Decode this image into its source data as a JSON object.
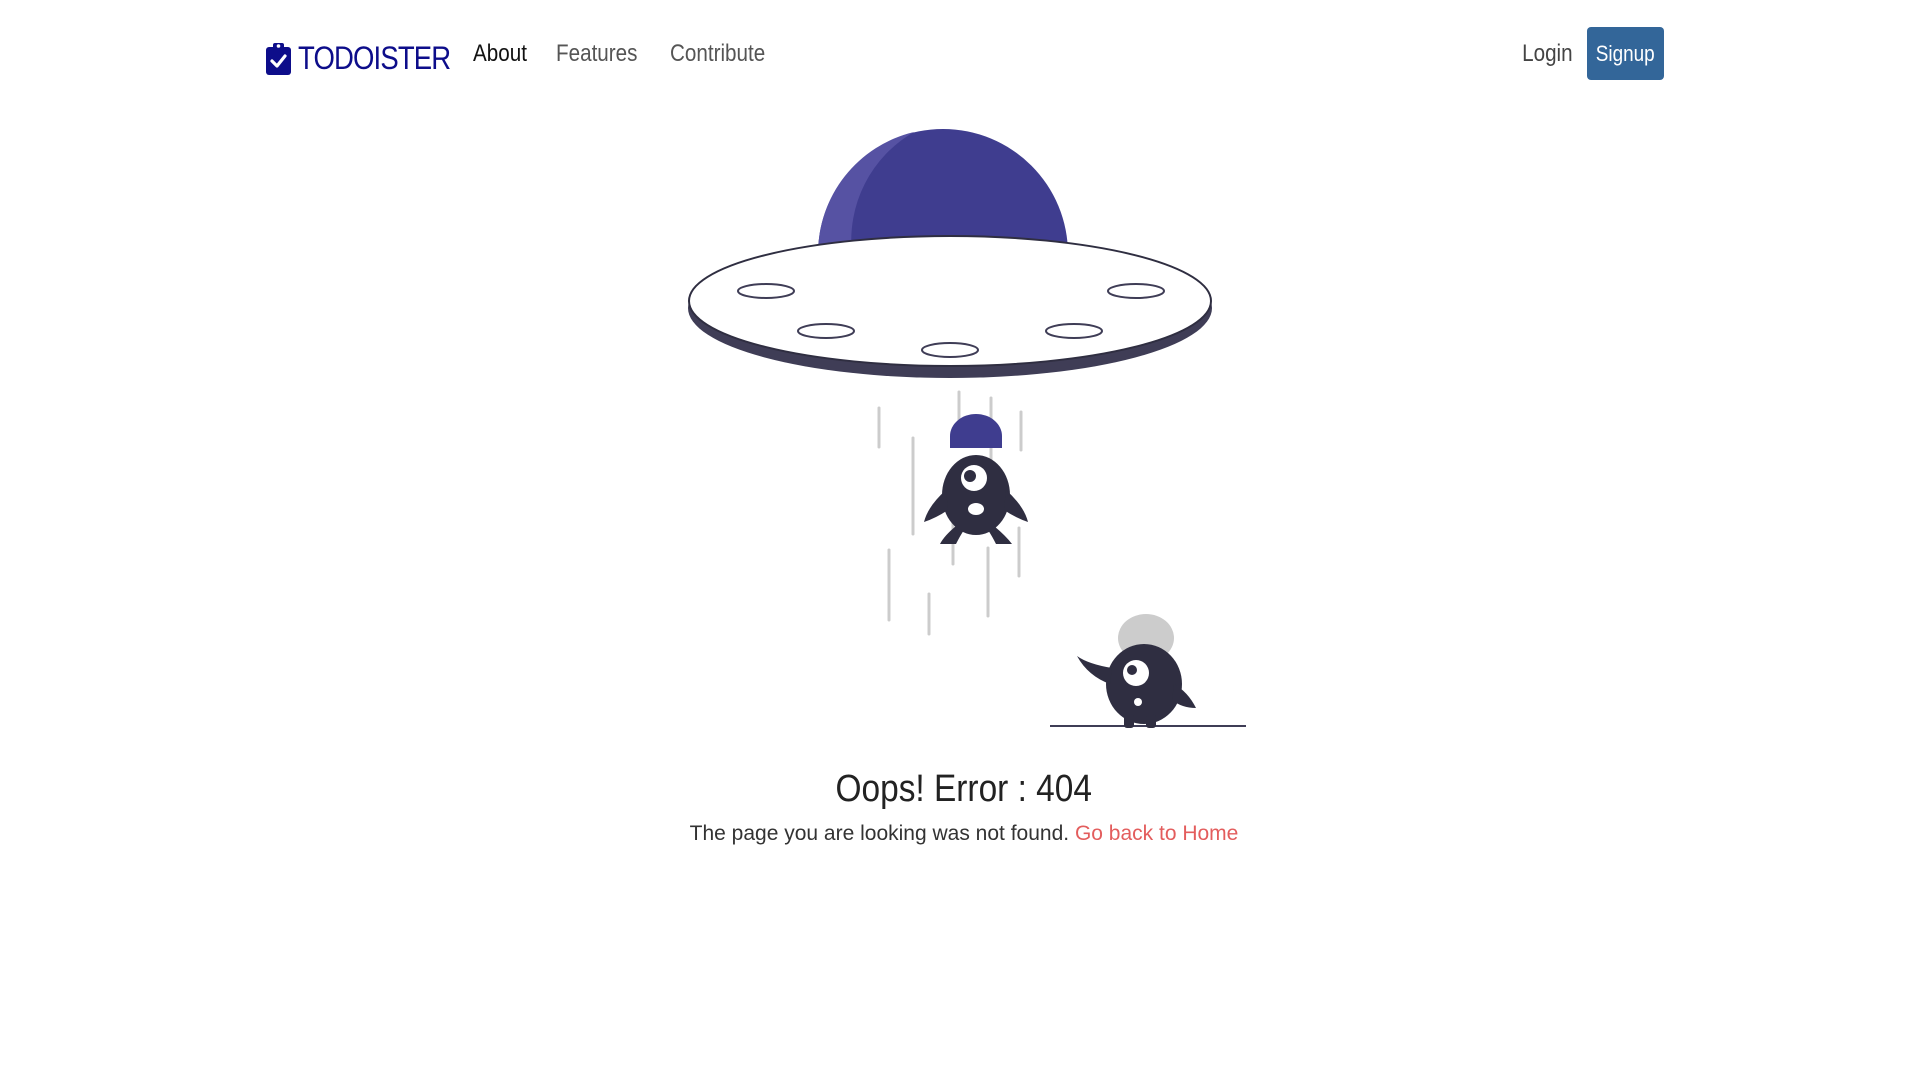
{
  "navbar": {
    "brand": {
      "icon": "clipboard-check-icon",
      "name": "TODOISTER",
      "color": "#0d0d8a"
    },
    "links": [
      {
        "label": "About",
        "active": true
      },
      {
        "label": "Features",
        "active": false
      },
      {
        "label": "Contribute",
        "active": false
      }
    ],
    "login_label": "Login",
    "signup_label": "Signup",
    "signup_color": "#336699"
  },
  "illustration": {
    "subject": "ufo-abduction-icon",
    "accent": "#3f3d8f",
    "figure_color": "#2f2e41"
  },
  "error": {
    "title": "Oops! Error : 404",
    "message": "The page you are looking was not found.",
    "link_label": "Go back to Home",
    "link_color": "#e35d5d"
  }
}
